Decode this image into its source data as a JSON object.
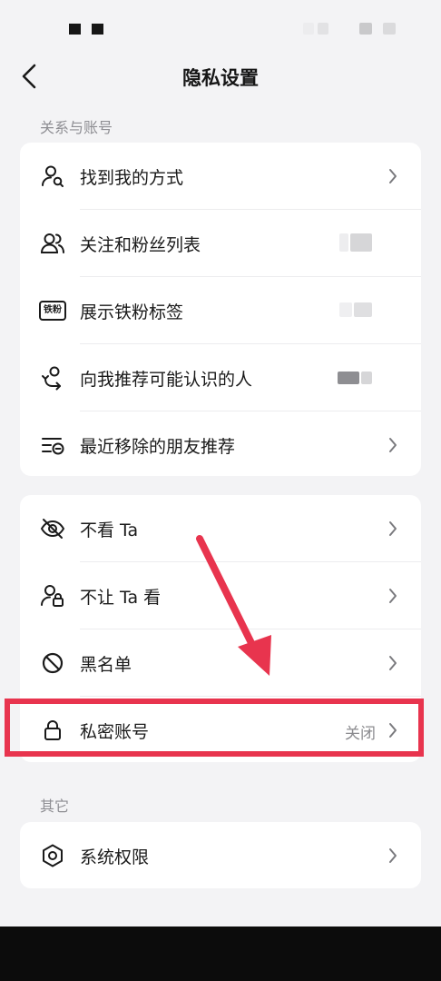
{
  "nav": {
    "title": "隐私设置"
  },
  "sections": {
    "relations_title": "关系与账号",
    "other_title": "其它"
  },
  "relations": {
    "find_me": "找到我的方式",
    "follow_list": "关注和粉丝列表",
    "fan_badge": "展示铁粉标签",
    "fan_badge_icon_text": "铁粉",
    "recommend": "向我推荐可能认识的人",
    "removed_recommend": "最近移除的朋友推荐"
  },
  "visibility": {
    "not_see": "不看 Ta",
    "not_let_see": "不让 Ta 看",
    "blacklist": "黑名单",
    "private_account": "私密账号",
    "private_account_value": "关闭"
  },
  "other": {
    "system_permissions": "系统权限"
  },
  "colors": {
    "accent_red": "#e8344e",
    "background": "#f3f3f5",
    "card": "#ffffff"
  }
}
